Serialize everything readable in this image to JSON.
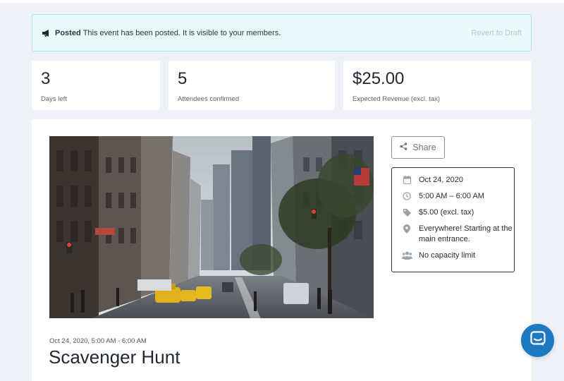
{
  "notice": {
    "status_label": "Posted",
    "message": "This event has been posted. It is visible to your members.",
    "revert_label": "Revert to Draft",
    "icon": "megaphone-icon"
  },
  "stats": [
    {
      "value": "3",
      "label": "Days left"
    },
    {
      "value": "5",
      "label": "Attendees confirmed"
    },
    {
      "value": "$25.00",
      "label": "Expected Revenue (excl. tax)"
    }
  ],
  "event": {
    "image_alt": "City street with skyscrapers and yellow taxis",
    "share_label": "Share",
    "details": [
      {
        "icon": "calendar-icon",
        "text": "Oct 24, 2020"
      },
      {
        "icon": "clock-icon",
        "text": "5:00 AM – 6:00 AM"
      },
      {
        "icon": "tag-icon",
        "text": "$5.00 (excl. tax)"
      },
      {
        "icon": "map-pin-icon",
        "text": "Everywhere! Starting at the main entrance."
      },
      {
        "icon": "people-icon",
        "text": "No capacity limit"
      }
    ],
    "date_line": "Oct 24, 2020, 5:00 AM - 6:00 AM",
    "title": "Scavenger Hunt"
  },
  "colors": {
    "page_bg": "#eef1f8",
    "notice_bg": "#eaf9fb",
    "notice_border": "#a7e4ea",
    "chat_button": "#1f79c0"
  },
  "chat": {
    "icon": "chat-bubble-icon"
  }
}
